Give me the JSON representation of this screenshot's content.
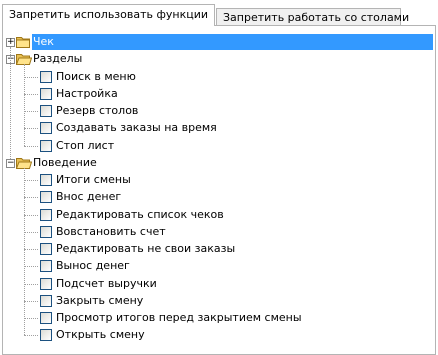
{
  "tabs": [
    {
      "label": "Запретить использовать функции",
      "active": true
    },
    {
      "label": "Запретить работать со столами",
      "active": false
    }
  ],
  "tree": {
    "selection_color": "#3399ff",
    "nodes": [
      {
        "label": "Чек",
        "expanded": false,
        "selected": true
      },
      {
        "label": "Разделы",
        "expanded": true,
        "children": [
          "Поиск в меню",
          "Настройка",
          "Резерв столов",
          "Создавать заказы на время",
          "Стоп лист"
        ]
      },
      {
        "label": "Поведение",
        "expanded": true,
        "children": [
          "Итоги смены",
          "Внос денег",
          "Редактировать список чеков",
          "Вовстановить счет",
          "Редактировать не свои заказы",
          "Вынос денег",
          "Подсчет выручки",
          "Закрыть смену",
          "Просмотр итогов перед закрытием смены",
          "Открыть смену"
        ]
      }
    ]
  }
}
